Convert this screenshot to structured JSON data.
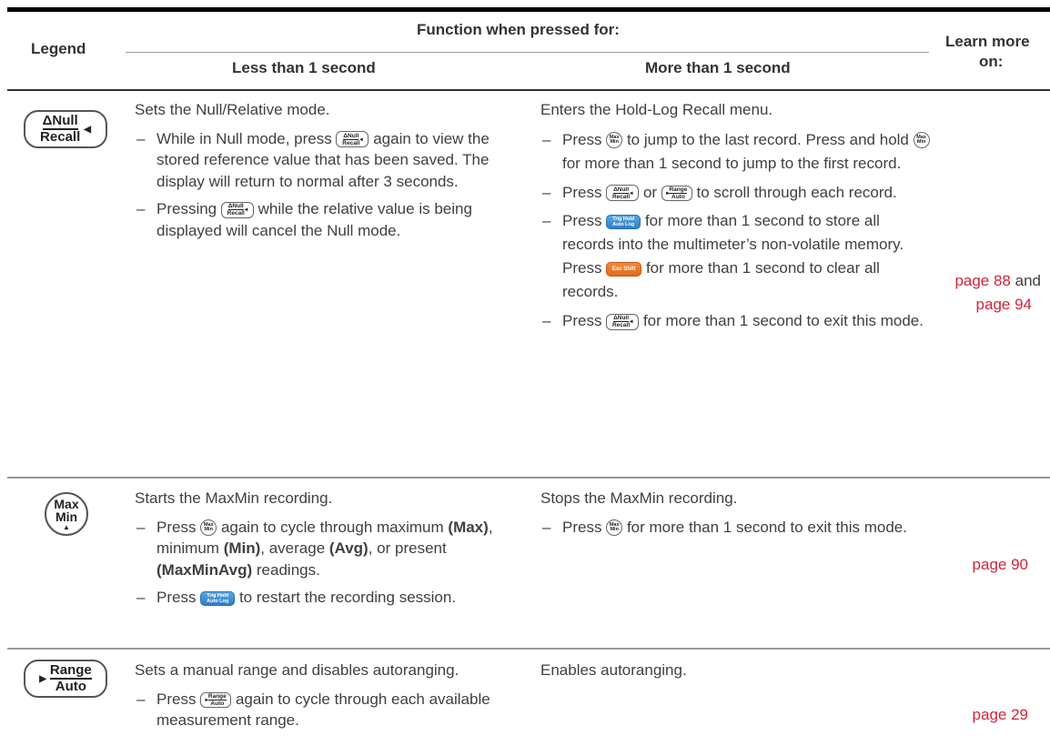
{
  "header": {
    "legend": "Legend",
    "function_when_pressed": "Function when pressed for:",
    "less_than": "Less than 1 second",
    "more_than": "More than 1 second",
    "learn_more_1": "Learn more",
    "learn_more_2": "on:"
  },
  "keys": {
    "null_top": "ΔNull",
    "null_bottom": "Recall",
    "max_top": "Max",
    "max_bottom": "Min",
    "range_top": "Range",
    "range_bottom": "Auto",
    "trig_top": "Trig Hold",
    "trig_bottom": "Auto Log",
    "esc": "Esc Shift"
  },
  "rows": [
    {
      "less": {
        "intro": "Sets the Null/Relative mode.",
        "b1a": "While in Null mode, press",
        "b1b": "again to view the stored reference value that has been saved. The display will return to normal after 3 seconds.",
        "b2a": "Pressing",
        "b2b": "while the relative value is being displayed will cancel the Null mode."
      },
      "more": {
        "intro": "Enters the Hold-Log Recall menu.",
        "b1a": "Press",
        "b1b": "to jump to the last record. Press and hold",
        "b1c": "for more than 1 second to jump to the first record.",
        "b2a": "Press",
        "b2b": "or",
        "b2c": "to scroll through each record.",
        "b3a": "Press",
        "b3b": "for more than 1 second to store all records into the multimeter’s non-volatile memory. Press",
        "b3c": "for more than 1 second to clear all records.",
        "b4a": "Press",
        "b4b": "for more than 1 second to exit this mode."
      },
      "learn_a": "page 88",
      "learn_and": "and",
      "learn_b": "page 94"
    },
    {
      "less": {
        "intro": "Starts the MaxMin recording.",
        "b1a": "Press",
        "b1b": "again to cycle through maximum",
        "b1_max": "(Max)",
        "b1c": ", minimum",
        "b1_min": "(Min)",
        "b1d": ", average",
        "b1_avg": "(Avg)",
        "b1e": ", or present",
        "b1_mma": "(MaxMinAvg)",
        "b1f": "readings.",
        "b2a": "Press",
        "b2b": "to restart the recording session."
      },
      "more": {
        "intro": "Stops the MaxMin recording.",
        "b1a": "Press",
        "b1b": "for more than 1 second to exit this mode."
      },
      "learn": "page 90"
    },
    {
      "less": {
        "intro": "Sets a manual range and disables autoranging.",
        "b1a": "Press",
        "b1b": "again to cycle through each available measurement range."
      },
      "more": {
        "intro": "Enables autoranging."
      },
      "learn": "page 29"
    }
  ],
  "dash": "–"
}
